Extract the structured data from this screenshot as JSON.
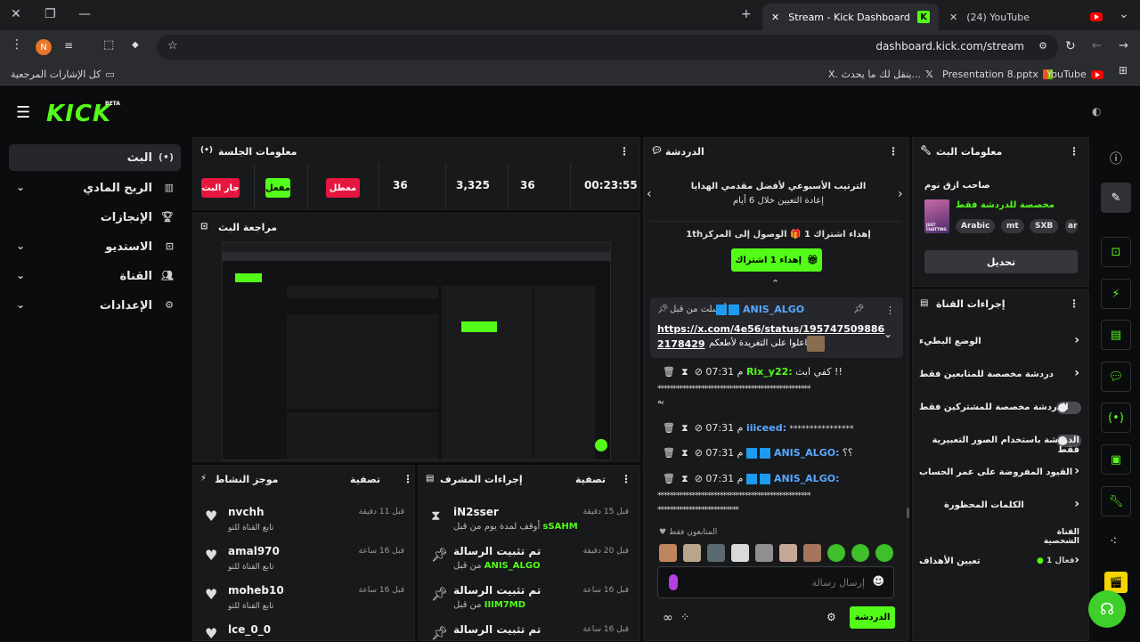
{
  "browser": {
    "tabs": [
      {
        "title": "Stream - Kick Dashboard"
      },
      {
        "title": "(24) YouTube"
      }
    ],
    "url": "dashboard.kick.com/stream",
    "profile_initial": "N",
    "bookmarks": {
      "all_label": "كل الإشارات المرجعية",
      "items": [
        "X. ينقل لك ما يحدث...",
        "Presentation 8.pptx",
        "YouTube"
      ]
    }
  },
  "app": {
    "logo": "KICK",
    "beta": "BETA",
    "nav": [
      {
        "label": "البث",
        "active": true
      },
      {
        "label": "الربح المادي"
      },
      {
        "label": "الإنجازات"
      },
      {
        "label": "الاستديو"
      },
      {
        "label": "القناة"
      },
      {
        "label": "الإعدادات"
      }
    ]
  },
  "session": {
    "title": "معلومات الجلسة",
    "buttons": {
      "live": "جار البث",
      "on": "مفعل",
      "off": "معطل"
    },
    "stats": [
      "36",
      "3,325",
      "36",
      "00:23:55"
    ]
  },
  "preview": {
    "title": "مراجعة البث"
  },
  "activity": {
    "title": "موجز النشاط",
    "filter": "تصفية",
    "items": [
      {
        "name": "nvchh",
        "sub": "تابع القناة للتو",
        "time": "قبل 11 دقيقة"
      },
      {
        "name": "amal970",
        "sub": "تابع القناة للتو",
        "time": "قبل 16 ساعة"
      },
      {
        "name": "moheb10",
        "sub": "تابع القناة للتو",
        "time": "قبل 16 ساعة"
      },
      {
        "name": "lce_0_0",
        "sub": "",
        "time": ""
      }
    ]
  },
  "modlog": {
    "title": "إجراءات المشرف",
    "filter": "تصفية",
    "items": [
      {
        "name": "iN2sser",
        "sub": "أوقف لمدة يوم من قبل",
        "by": "sSAHM",
        "time": "قبل 15 دقيقة"
      },
      {
        "name": "تم تثبيت الرسالة",
        "sub": "من قبل",
        "by": "ANIS_ALGO",
        "time": "قبل 20 دقيقة"
      },
      {
        "name": "تم تثبيت الرسالة",
        "sub": "من قبل",
        "by": "IIIM7MD",
        "time": "قبل 16 ساعة"
      },
      {
        "name": "تم تثبيت الرسالة",
        "sub": "",
        "by": "",
        "time": "قبل 16 ساعة"
      }
    ]
  },
  "chat": {
    "title": "الدردشة",
    "leaderboard_title": "الترتيب الأسبوعي لأفضل مقدمي الهدايا",
    "leaderboard_sub": "إعادة التعيين خلال 6 أيام",
    "gift_goal": "1thإهداء اشتراك 1 🎁 الوصول إلى المركز",
    "gift_button": "إهداء 1 اشتراك",
    "pinned_by": "أرسلت من قبل",
    "pinned_user": "ANIS_ALGO",
    "pinned_link": "https://x.com/4e56/status/1957475098862178429",
    "pinned_link_line1": "https://x.com/4e56/status/195747509886",
    "pinned_link_line2": "2178429",
    "pinned_text": "تفاعلوا على التغريدة لأطعكم",
    "messages": [
      {
        "time": "07:31 م",
        "user": "Rix_y22:",
        "text": "كفي ابث !!"
      },
      {
        "time": "",
        "user": "",
        "text": "*************************************************"
      },
      {
        "time": "",
        "user": "",
        "text": "يه"
      },
      {
        "time": "07:31 م",
        "user": "iiiceed:",
        "text": "****************"
      },
      {
        "time": "07:31 م",
        "user": "ANIS_ALGO:",
        "text": "؟؟"
      },
      {
        "time": "07:31 م",
        "user": "ANIS_ALGO:",
        "text": ""
      },
      {
        "time": "",
        "user": "",
        "text": "*************************************************"
      },
      {
        "time": "",
        "user": "",
        "text": "**************************"
      }
    ],
    "chatters_label": "المتابعون فقط",
    "input_placeholder": "إرسال رسالة",
    "send_label": "الدردشة"
  },
  "stream_info": {
    "title": "معلومات البث",
    "stream_title": "صاحب ازق نوم",
    "category": "مخصصة للدردشة فقط",
    "tags": [
      "Arabic",
      "mt",
      "SXB",
      "ar"
    ],
    "edit_label": "تحديل",
    "thumb_text": "JUST CHATTING"
  },
  "channel_actions": {
    "title": "إجراءات القناة",
    "items": [
      {
        "label": "الوضع البطيء",
        "type": "arrow"
      },
      {
        "label": "دردشة مخصصة للمتابعين فقط",
        "type": "arrow"
      },
      {
        "label": "الدردشة مخصصة للمشتركين فقط",
        "type": "toggle"
      },
      {
        "label": "الدردشة باستخدام الصور التعبيرية فقط",
        "type": "toggle"
      },
      {
        "label": "القيود المفروضة على عمر الحساب",
        "type": "arrow"
      },
      {
        "label": "الكلمات المحظورة",
        "type": "arrow"
      },
      {
        "label": "القناة الشخصية",
        "type": "header"
      },
      {
        "label": "تعيين الأهداف",
        "type": "goal",
        "status": "فعال 1"
      }
    ]
  },
  "colors": {
    "accent": "#53fc18",
    "danger": "#e5173f"
  }
}
